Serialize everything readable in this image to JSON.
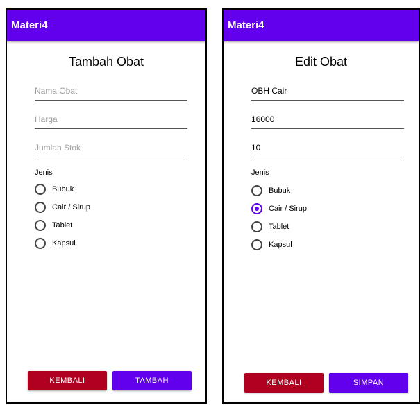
{
  "colors": {
    "primary": "#6200ee",
    "danger": "#b00020"
  },
  "left_screen": {
    "app_title": "Materi4",
    "screen_title": "Tambah Obat",
    "fields": {
      "nama_placeholder": "Nama Obat",
      "harga_placeholder": "Harga",
      "stok_placeholder": "Jumlah Stok"
    },
    "jenis_label": "Jenis",
    "options": [
      "Bubuk",
      "Cair / Sirup",
      "Tablet",
      "Kapsul"
    ],
    "selected": null,
    "back_label": "KEMBALI",
    "submit_label": "TAMBAH"
  },
  "right_screen": {
    "app_title": "Materi4",
    "screen_title": "Edit Obat",
    "fields": {
      "nama_value": "OBH Cair",
      "harga_value": "16000",
      "stok_value": "10"
    },
    "jenis_label": "Jenis",
    "options": [
      "Bubuk",
      "Cair / Sirup",
      "Tablet",
      "Kapsul"
    ],
    "selected": "Cair / Sirup",
    "back_label": "KEMBALI",
    "submit_label": "SIMPAN"
  }
}
